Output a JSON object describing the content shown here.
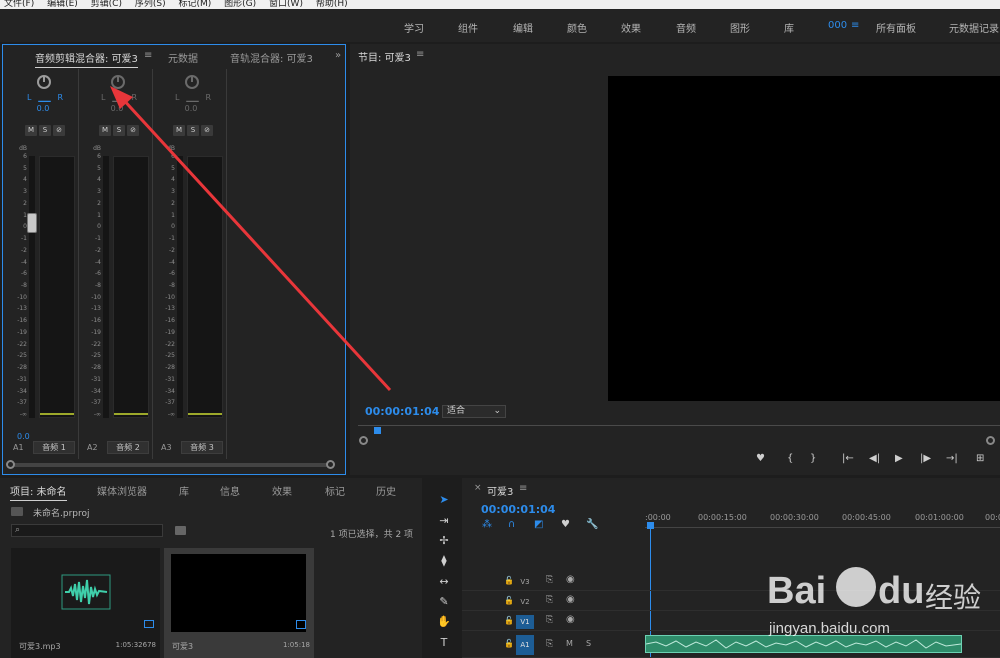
{
  "menu": [
    "文件(F)",
    "编辑(E)",
    "剪辑(C)",
    "序列(S)",
    "标记(M)",
    "图形(G)",
    "窗口(W)",
    "帮助(H)"
  ],
  "workspaces": [
    "学习",
    "组件",
    "编辑",
    "颜色",
    "效果",
    "音频",
    "图形",
    "库",
    "000",
    "所有面板",
    "元数据记录"
  ],
  "workspace_menu_icon": "hamburger-icon",
  "mixer_panel": {
    "tabs": [
      "音频剪辑混合器: 可爱3",
      "元数据",
      "音轨混合器: 可爱3"
    ],
    "panel_menu_icon": "hamburger-icon",
    "overflow_icon": "double-chevron-right-icon",
    "pan_left": "L",
    "pan_right": "R",
    "pan_value": "0.0",
    "buttons": [
      "M",
      "S",
      "⊘"
    ],
    "db_label": "dB",
    "scale": [
      "6",
      "5",
      "4",
      "3",
      "2",
      "1",
      "0",
      "-1",
      "-2",
      "-4",
      "-6",
      "-8",
      "-10",
      "-13",
      "-16",
      "-19",
      "-22",
      "-25",
      "-28",
      "-31",
      "-34",
      "-37",
      "-∞"
    ],
    "fader_value": "0.0",
    "strips": [
      {
        "track": "A1",
        "name": "音频 1"
      },
      {
        "track": "A2",
        "name": "音频 2"
      },
      {
        "track": "A3",
        "name": "音频 3"
      }
    ]
  },
  "program_panel": {
    "title": "节目: 可爱3",
    "timecode": "00:00:01:04",
    "fit": "适合",
    "transport": [
      "♥",
      "{",
      "}",
      "|←",
      "◀|",
      "▶",
      "|▶",
      "→|",
      "⊞"
    ]
  },
  "project_panel": {
    "tabs": [
      "项目: 未命名",
      "媒体浏览器",
      "库",
      "信息",
      "效果",
      "标记",
      "历史"
    ],
    "project_file": "未命名.prproj",
    "selection": "1 项已选择，共 2 项",
    "search_placeholder": "",
    "items": [
      {
        "name": "可爱3.mp3",
        "duration": "1:05:32678"
      },
      {
        "name": "可爱3",
        "duration": "1:05:18"
      }
    ]
  },
  "timeline_panel": {
    "tab": "可爱3",
    "timecode": "00:00:01:04",
    "ruler": [
      ":00:00",
      "00:00:15:00",
      "00:00:30:00",
      "00:00:45:00",
      "00:01:00:00",
      "00:0"
    ],
    "tracks": [
      {
        "label": "V3",
        "type": "video"
      },
      {
        "label": "V2",
        "type": "video"
      },
      {
        "label": "V1",
        "type": "video",
        "selected": true
      },
      {
        "label": "A1",
        "type": "audio",
        "selected": true
      }
    ],
    "audio_buttons": [
      "M",
      "S"
    ]
  },
  "watermark": {
    "brand": "Bai",
    "brand2": "du",
    "cn": "经验",
    "url": "jingyan.baidu.com"
  },
  "colors": {
    "accent": "#2d8ceb",
    "arrow": "#e8363a",
    "clip": "#2f8c6a"
  }
}
